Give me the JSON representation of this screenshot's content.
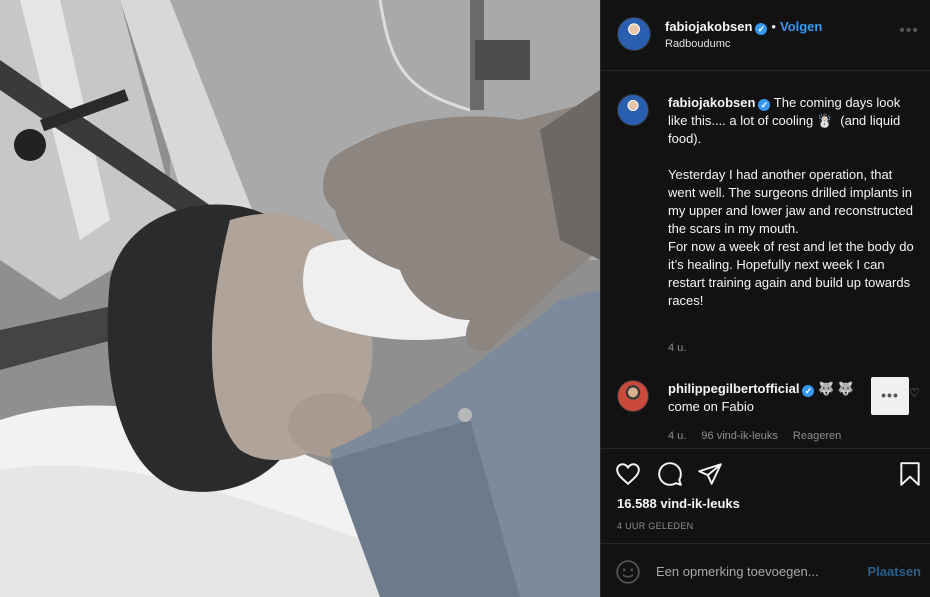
{
  "post": {
    "username": "fabiojakobsen",
    "follow_label": "Volgen",
    "separator": "•",
    "location": "Radboudumc",
    "more_label": "•••"
  },
  "caption": {
    "username": "fabiojakobsen",
    "text": " The coming days look like this.... a lot of cooling ☃️  (and liquid food).\n\nYesterday I had another operation, that went well. The surgeons drilled implants in my upper and lower jaw and reconstructed the scars in my mouth.\nFor now a week of rest and let the body do it’s healing. Hopefully next week I can restart training again and build up towards races!",
    "time": "4 u."
  },
  "comment": {
    "username": "philippegilbertofficial",
    "emojis": " 🐺 🐺",
    "text": "come on Fabio",
    "time": "4 u.",
    "likes": "96 vind-ik-leuks",
    "reply_label": "Reageren",
    "more_label": "•••"
  },
  "stats": {
    "likes": "16.588 vind-ik-leuks",
    "time_ago": "4 UUR GELEDEN"
  },
  "add_comment": {
    "placeholder": "Een opmerking toevoegen...",
    "post_label": "Plaatsen"
  },
  "icons": {
    "like": "heart-icon",
    "comment": "comment-bubble-icon",
    "share": "paper-plane-icon",
    "save": "bookmark-icon",
    "emoji": "smiley-icon",
    "verified": "verified-badge-icon"
  },
  "colors": {
    "background": "#121212",
    "accent": "#3897f0",
    "muted": "#8e8e8e"
  }
}
